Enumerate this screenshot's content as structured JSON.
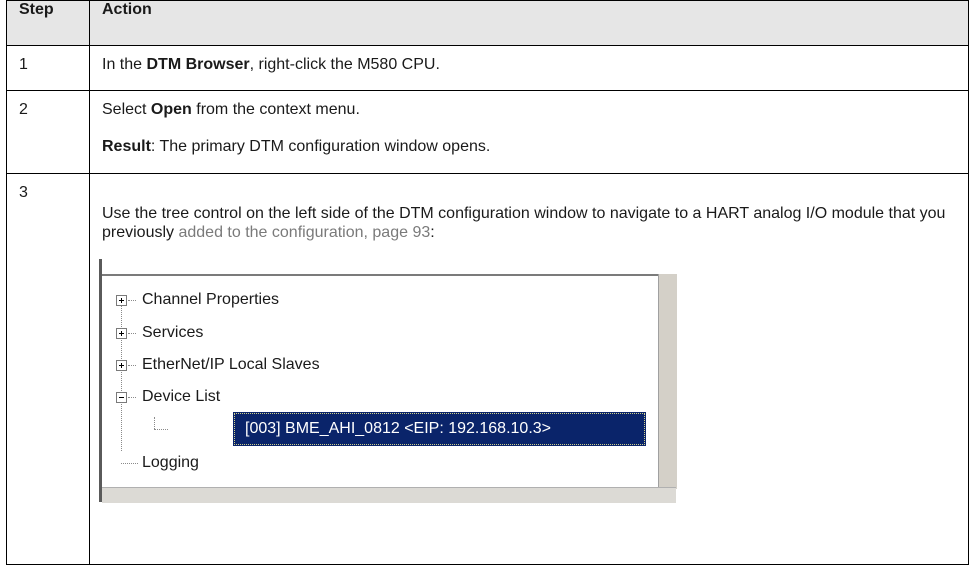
{
  "table": {
    "headers": {
      "step": "Step",
      "action": "Action"
    },
    "rows": [
      {
        "step": "1",
        "parts": [
          "In the ",
          "DTM Browser",
          ", right-click the M580 CPU."
        ]
      },
      {
        "step": "2",
        "line1": [
          "Select ",
          "Open",
          " from the context menu."
        ],
        "line2": [
          "Result",
          ": The primary DTM configuration window opens."
        ]
      },
      {
        "step": "3",
        "text": "Use the tree control on the left side of the DTM configuration window to navigate to a HART analog I/O module that you previously ",
        "link": "added to the configuration, page 93",
        "suffix": ":"
      }
    ]
  },
  "tree": {
    "items": [
      {
        "label": "Channel Properties",
        "state": "collapsed"
      },
      {
        "label": "Services",
        "state": "collapsed"
      },
      {
        "label": "EtherNet/IP Local Slaves",
        "state": "collapsed"
      },
      {
        "label": "Device List",
        "state": "expanded"
      },
      {
        "label": "Logging",
        "state": "leaf"
      }
    ],
    "selected": "[003] BME_AHI_0812 <EIP: 192.168.10.3>",
    "selection_color": "#0a246a"
  }
}
